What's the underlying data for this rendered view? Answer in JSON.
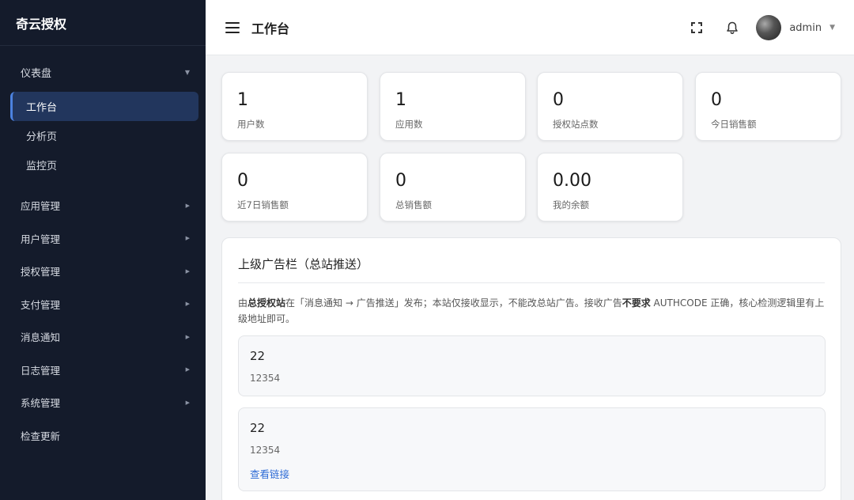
{
  "brand": "奇云授权",
  "sidebar": {
    "dashboard_group": "仪表盘",
    "sub_items": [
      {
        "label": "工作台",
        "active": true
      },
      {
        "label": "分析页",
        "active": false
      },
      {
        "label": "监控页",
        "active": false
      }
    ],
    "groups": [
      {
        "label": "应用管理"
      },
      {
        "label": "用户管理"
      },
      {
        "label": "授权管理"
      },
      {
        "label": "支付管理"
      },
      {
        "label": "消息通知"
      },
      {
        "label": "日志管理"
      },
      {
        "label": "系统管理"
      },
      {
        "label": "检查更新"
      }
    ]
  },
  "header": {
    "title": "工作台",
    "user_name": "admin"
  },
  "stats": [
    {
      "value": "1",
      "label": "用户数"
    },
    {
      "value": "1",
      "label": "应用数"
    },
    {
      "value": "0",
      "label": "授权站点数"
    },
    {
      "value": "0",
      "label": "今日销售额"
    },
    {
      "value": "0",
      "label": "近7日销售额"
    },
    {
      "value": "0",
      "label": "总销售额"
    },
    {
      "value": "0.00",
      "label": "我的余额"
    }
  ],
  "ad_panel": {
    "title": "上级广告栏（总站推送）",
    "desc_parts": [
      "由",
      "总授权站",
      "在「消息通知 → 广告推送」发布；本站仅接收显示，不能改总站广告。接收广告",
      "不要求",
      " AUTHCODE 正确，核心检测逻辑里有上级地址即可。"
    ],
    "items": [
      {
        "title": "22",
        "body": "12354"
      },
      {
        "title": "22",
        "body": "12354",
        "link": "查看链接"
      }
    ]
  },
  "colors": {
    "sidebar_bg": "#141b2b",
    "active_item_bg": "#22365d",
    "accent": "#4c82e0",
    "link": "#2f6cd6"
  }
}
